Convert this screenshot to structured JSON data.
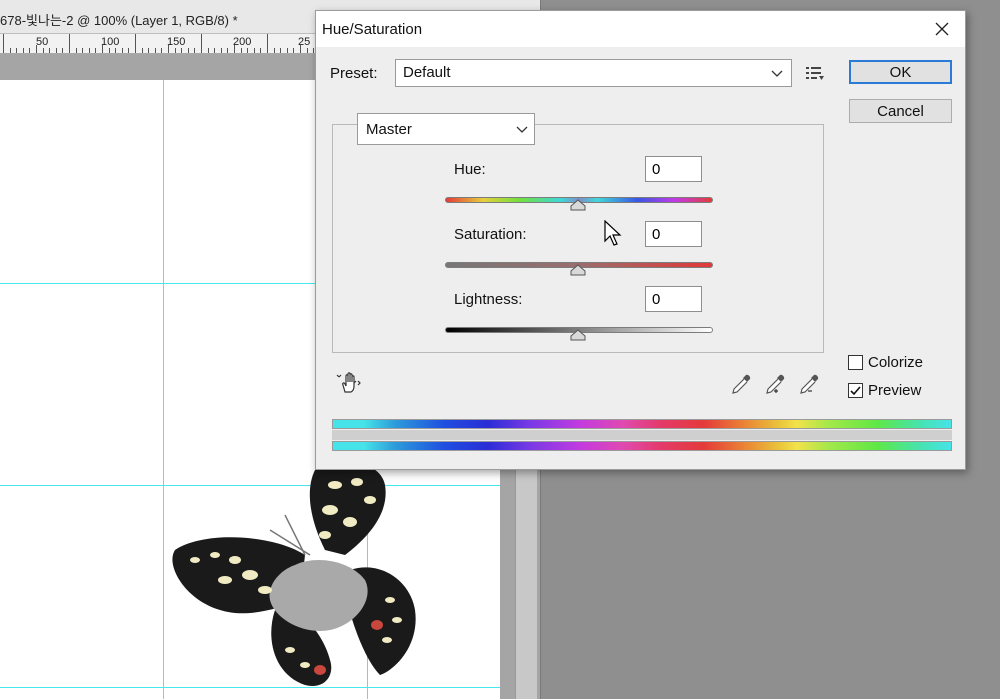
{
  "document": {
    "title": "678-빛나는-2 @ 100% (Layer 1, RGB/8) *",
    "ruler_labels": [
      "50",
      "100",
      "150",
      "200",
      "25"
    ]
  },
  "dialog": {
    "title": "Hue/Saturation",
    "preset": {
      "label": "Preset:",
      "value": "Default"
    },
    "buttons": {
      "ok": "OK",
      "cancel": "Cancel"
    },
    "channel": "Master",
    "params": {
      "hue": {
        "label": "Hue:",
        "value": "0"
      },
      "saturation": {
        "label": "Saturation:",
        "value": "0"
      },
      "lightness": {
        "label": "Lightness:",
        "value": "0"
      }
    },
    "colorize": {
      "label": "Colorize",
      "checked": false
    },
    "preview": {
      "label": "Preview",
      "checked": true
    }
  },
  "icons": {
    "close": "close-icon",
    "preset_menu": "preset-options-icon",
    "hand": "targeted-adjustment-hand-icon",
    "eyedroppers": [
      "eyedropper-icon",
      "eyedropper-plus-icon",
      "eyedropper-minus-icon"
    ]
  },
  "colors": {
    "guide": "#46e8ee",
    "ok_border": "#2b7bd6"
  }
}
